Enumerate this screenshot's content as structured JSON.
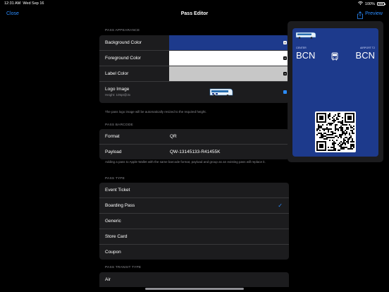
{
  "status": {
    "time": "12:31 AM",
    "date": "Wed Sep 16",
    "battery": "100%"
  },
  "navbar": {
    "close": "Close",
    "title": "Pass Editor",
    "preview": "Preview"
  },
  "appearance": {
    "header": "PASS APPEARANCE",
    "background_label": "Background Color",
    "foreground_label": "Foreground Color",
    "label_color_label": "Label Color",
    "background_color": "#1d3a8c",
    "foreground_color": "#ffffff",
    "label_color": "#c7c7c7",
    "logo_label": "Logo Image",
    "logo_sub": "Height: 105pt@3x",
    "note": "The pass logo image will be automatically resized to the required height."
  },
  "barcode": {
    "header": "PASS BARCODE",
    "format_label": "Format",
    "format_value": "QR",
    "payload_label": "Payload",
    "payload_value": "QW-13145133-R41455K",
    "note": "Adding a pass to Apple Wallet with the same barcode format, payload and group as an existing pass will replace it."
  },
  "pass_type": {
    "header": "PASS TYPE",
    "options": [
      "Event Ticket",
      "Boarding Pass",
      "Generic",
      "Store Card",
      "Coupon"
    ],
    "selected": "Boarding Pass"
  },
  "transit": {
    "header": "PASS TRANSIT TYPE",
    "first_option": "Air"
  },
  "preview": {
    "origin_label": "CENTER",
    "origin": "BCN",
    "dest_label": "AIRPORT T2",
    "dest": "BCN"
  }
}
